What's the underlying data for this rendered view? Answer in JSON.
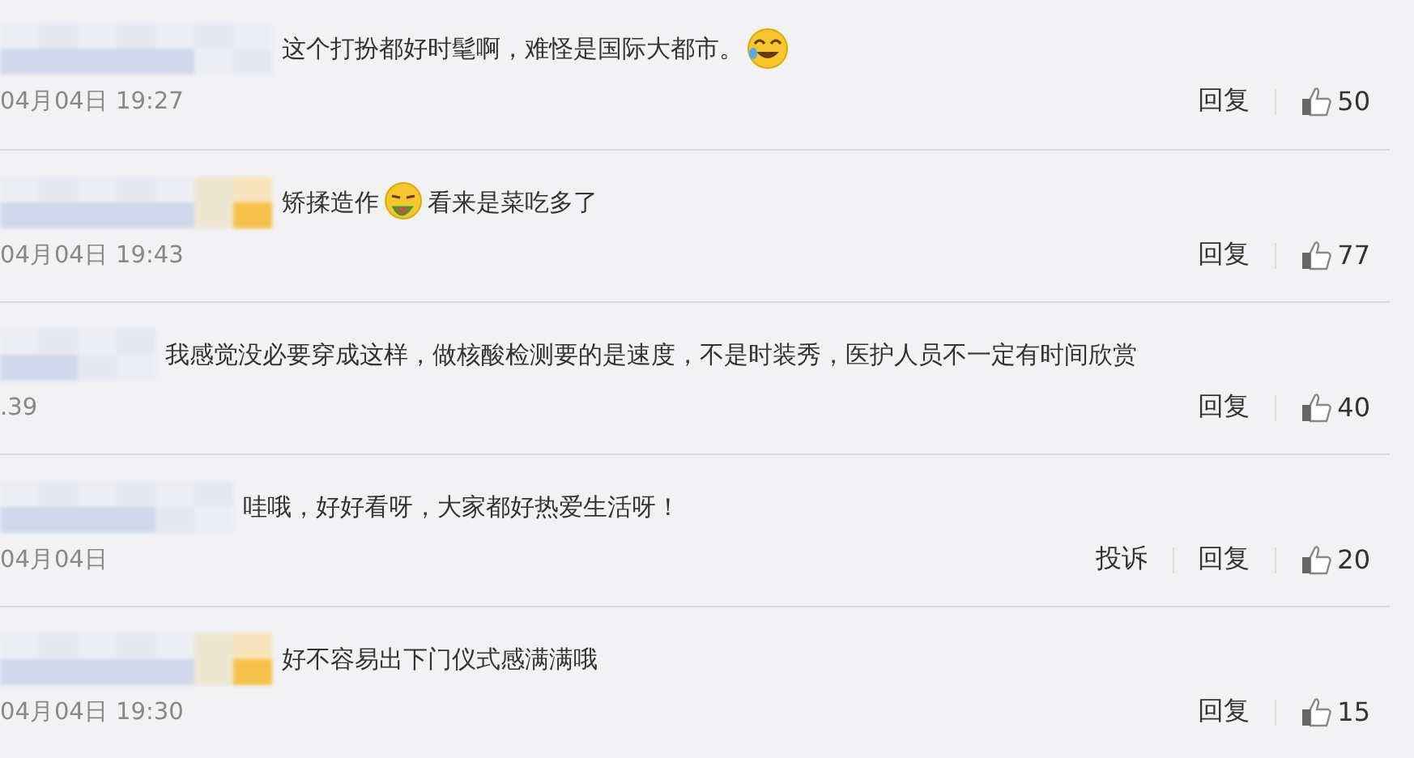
{
  "comments": [
    {
      "segments": [
        {
          "kind": "text",
          "text": "这个打扮都好时髦啊，难怪是国际大都市。"
        },
        {
          "kind": "laugh-sticker"
        }
      ],
      "time": "04月04日 19:27",
      "actions": [
        "回复"
      ],
      "likes": "50"
    },
    {
      "segments": [
        {
          "kind": "text",
          "text": "矫揉造作"
        },
        {
          "kind": "melon-sticker"
        },
        {
          "kind": "text",
          "text": "看来是菜吃多了"
        }
      ],
      "time": "04月04日 19:43",
      "actions": [
        "回复"
      ],
      "likes": "77"
    },
    {
      "segments": [
        {
          "kind": "text",
          "text": "我感觉没必要穿成这样，做核酸检测要的是速度，不是时装秀，医护人员不一定有时间欣赏"
        }
      ],
      "time": ".39",
      "actions": [
        "回复"
      ],
      "likes": "40"
    },
    {
      "segments": [
        {
          "kind": "text",
          "text": "哇哦，好好看呀，大家都好热爱生活呀！"
        }
      ],
      "time": "04月04日",
      "actions": [
        "投诉",
        "回复"
      ],
      "likes": "20"
    },
    {
      "segments": [
        {
          "kind": "text",
          "text": "好不容易出下门仪式感满满哦"
        }
      ],
      "time": "04月04日 19:30",
      "actions": [
        "回复"
      ],
      "likes": "15"
    }
  ]
}
